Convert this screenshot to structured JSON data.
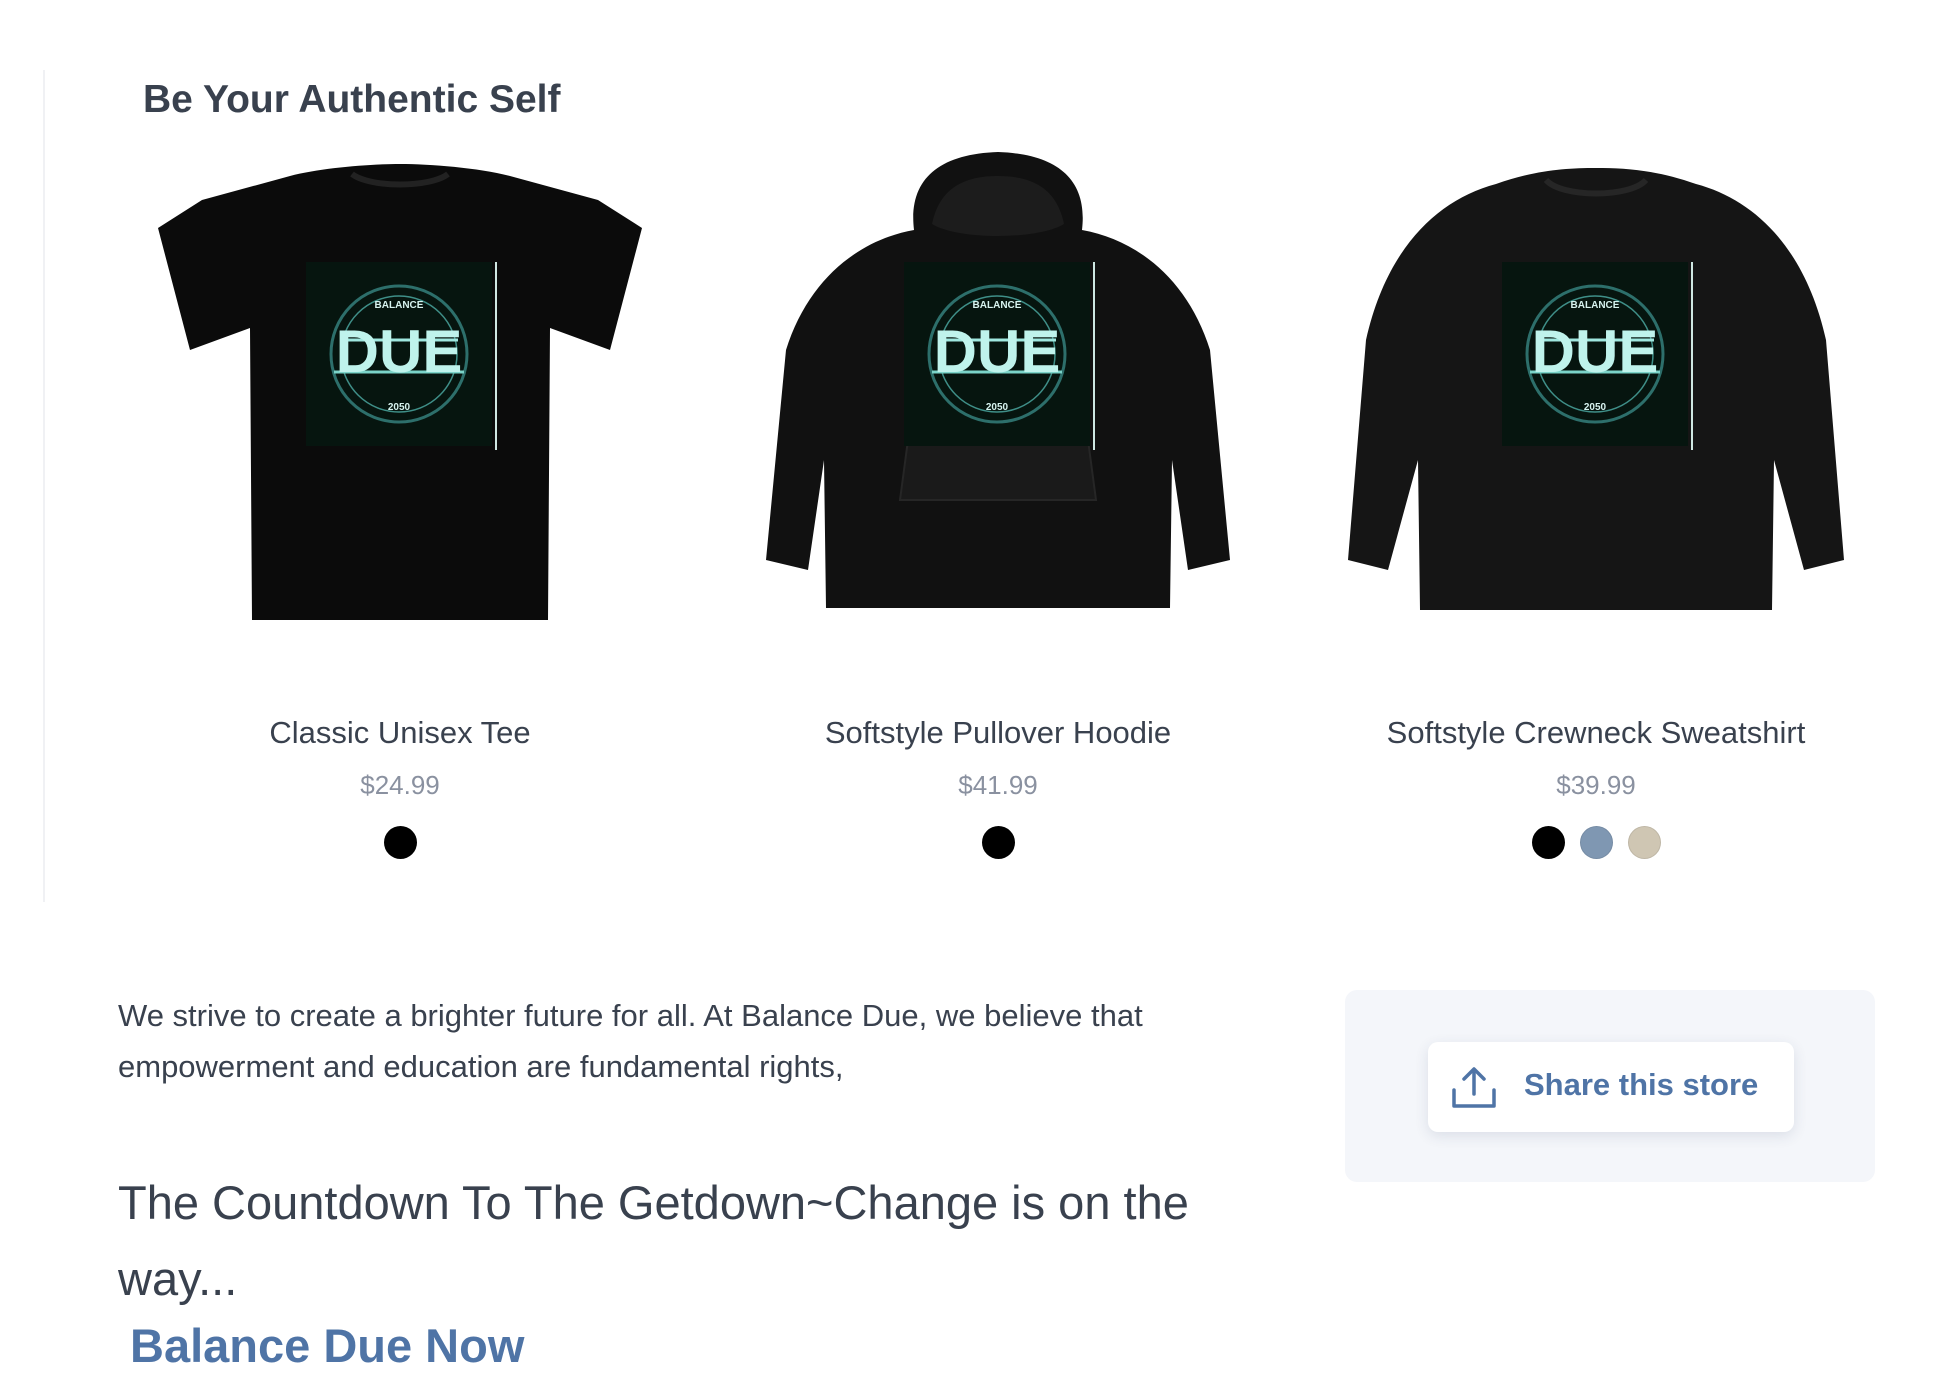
{
  "section": {
    "title": "Be Your Authentic Self"
  },
  "products": [
    {
      "name": "Classic Unisex Tee",
      "price": "$24.99",
      "garment_icon": "tshirt-icon",
      "colors": [
        "#000000"
      ]
    },
    {
      "name": "Softstyle Pullover Hoodie",
      "price": "$41.99",
      "garment_icon": "hoodie-icon",
      "colors": [
        "#000000"
      ]
    },
    {
      "name": "Softstyle Crewneck Sweatshirt",
      "price": "$39.99",
      "garment_icon": "sweatshirt-icon",
      "colors": [
        "#000000",
        "#7f97b2",
        "#cfc6b3"
      ]
    }
  ],
  "logo": {
    "text_main": "DUE",
    "text_top": "BALANCE",
    "text_bottom": "2050"
  },
  "about": {
    "text": "We strive to create a brighter future for all. At Balance Due, we believe that empowerment and education are fundamental rights,"
  },
  "countdown": {
    "text": "The Countdown To The Getdown~Change is on the way..."
  },
  "cta": {
    "label": "Balance Due Now"
  },
  "share": {
    "label": "Share this store",
    "icon": "share-upload-icon"
  },
  "colors": {
    "accent": "#4f74a6",
    "text": "#39414e",
    "muted": "#8a91a0",
    "panel_bg": "#f4f6fa"
  }
}
